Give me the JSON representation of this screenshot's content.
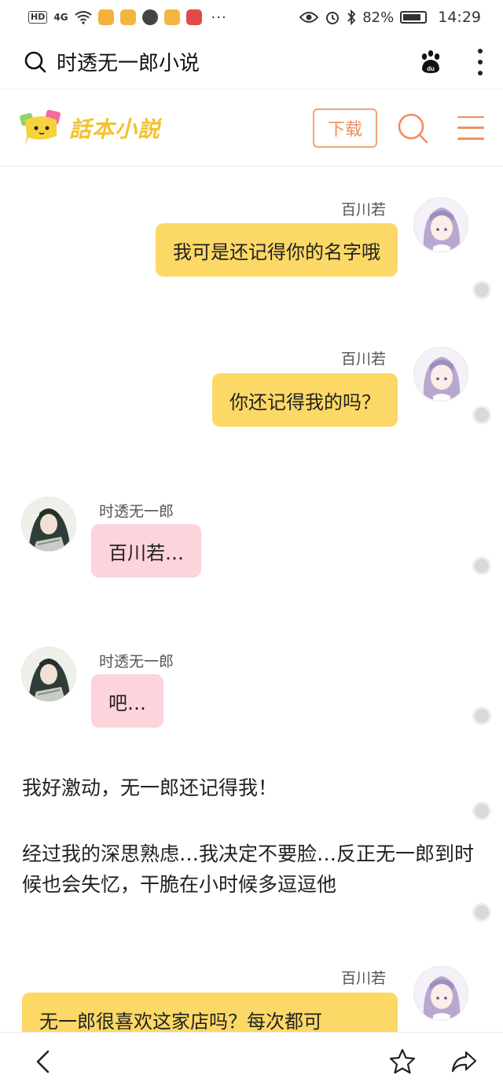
{
  "status_bar": {
    "left": {
      "hd": "HD",
      "signal": "4G",
      "more": "···"
    },
    "battery": "82%",
    "time": "14:29"
  },
  "browser": {
    "query": "时透无一郎小说",
    "icons": [
      "search-icon",
      "baidu-paw-icon",
      "more-vertical-icon"
    ]
  },
  "site": {
    "logo_text": "話本小説",
    "download_label": "下载",
    "accent_color": "#ef8f5c",
    "logo_color": "#f2c12e"
  },
  "chat": {
    "messages": [
      {
        "side": "right",
        "speaker": "百川若",
        "text": "我可是还记得你的名字哦"
      },
      {
        "side": "right",
        "speaker": "百川若",
        "text": "你还记得我的吗？"
      },
      {
        "side": "left",
        "speaker": "时透无一郎",
        "text": "百川若…"
      },
      {
        "side": "left",
        "speaker": "时透无一郎",
        "text": "吧…"
      },
      {
        "side": "right",
        "speaker": "百川若",
        "text": "无一郎很喜欢这家店吗？每次都可"
      }
    ],
    "narration": [
      "我好激动，无一郎还记得我！",
      "经过我的深思熟虑…我决定不要脸…反正无一郎到时候也会失忆，干脆在小时候多逗逗他"
    ],
    "colors": {
      "right_bubble": "#fcd866",
      "left_bubble": "#fdd3dc"
    }
  },
  "bottom_bar": {
    "icons": [
      "back-icon",
      "star-icon",
      "share-icon"
    ]
  }
}
